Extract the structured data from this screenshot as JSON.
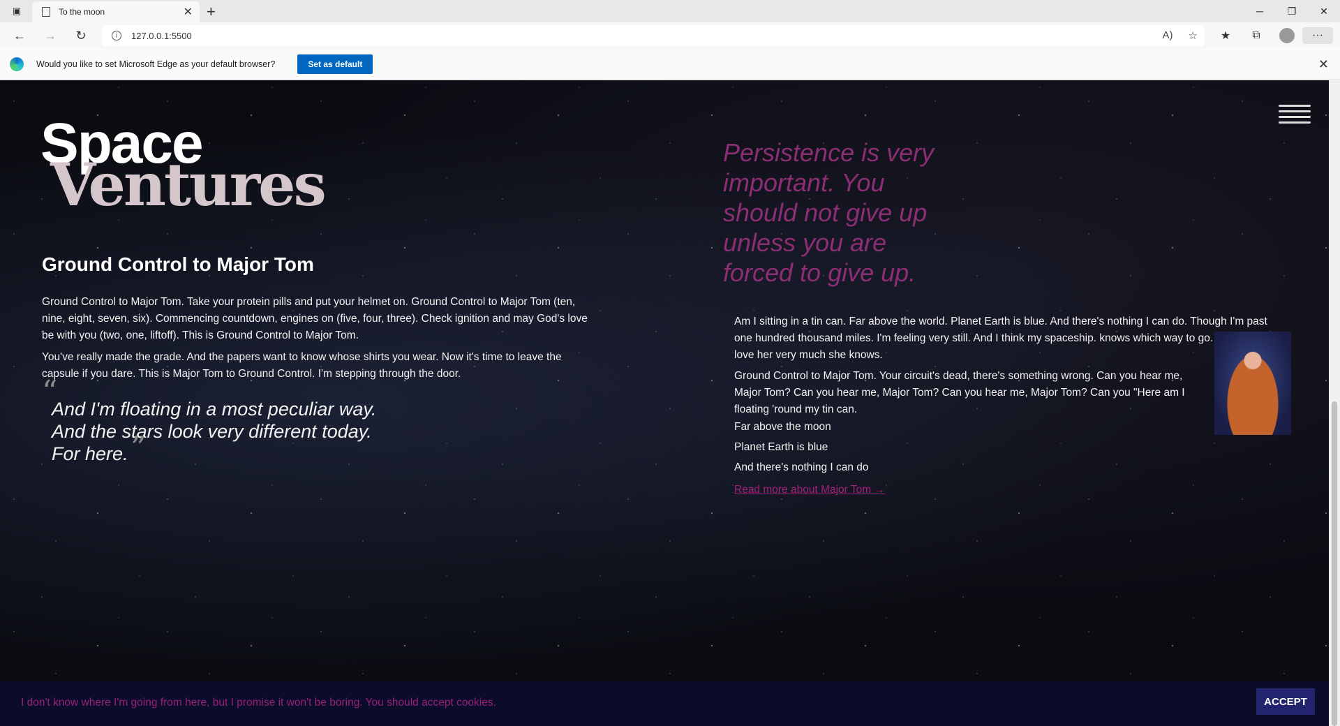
{
  "browser": {
    "tab_title": "To the moon",
    "url": "127.0.0.1:5500",
    "infobar_text": "Would you like to set Microsoft Edge as your default browser?",
    "infobar_button": "Set as default"
  },
  "site": {
    "logo_top": "Space",
    "logo_bottom": "Ventures",
    "heading": "Ground Control to Major Tom",
    "para1": "Ground Control to Major Tom. Take your protein pills and put your helmet on. Ground Control to Major Tom (ten, nine, eight, seven, six). Commencing countdown, engines on (five, four, three). Check ignition and may God's love be with you (two, one, liftoff). This is Ground Control to Major Tom.",
    "para2": "You've really made the grade. And the papers want to know whose shirts you wear. Now it's time to leave the capsule if you dare. This is Major Tom to Ground Control. I'm stepping through the door.",
    "quote_line1": "And I'm floating in a most peculiar way.",
    "quote_line2": "And the stars look very different today.",
    "quote_line3": "For here.",
    "pullquote": "Persistence is very important. You should not give up unless you are forced to give up.",
    "rpara1": "Am I sitting in a tin can. Far above the world. Planet Earth is blue. And there's nothing I can do. Though I'm past one hundred thousand miles. I'm feeling very still. And I think my spaceship. knows which way to go. Tell my wife I love her very much she knows.",
    "rpara2": "Ground Control to Major Tom. Your circuit's dead, there's something wrong. Can you hear me, Major Tom? Can you hear me, Major Tom? Can you hear me, Major Tom? Can you \"Here am I floating 'round my tin can.",
    "line1": "Far above the moon",
    "line2": "Planet Earth is blue",
    "line3": "And there's nothing I can do",
    "read_more": "Read more about Major Tom →"
  },
  "cookie": {
    "message": "I don't know where I'm going from here, but I promise it won't be boring. You should accept cookies.",
    "accept": "ACCEPT"
  },
  "colors": {
    "accent_magenta": "#a2247e",
    "cookie_bg": "#0a0c2a",
    "accept_bg": "#23246e",
    "edge_blue": "#0067c0"
  }
}
